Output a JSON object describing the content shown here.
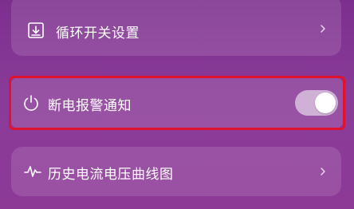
{
  "settings": {
    "items": [
      {
        "label": "循环开关设置",
        "icon": "download-box-icon",
        "control": "chevron"
      },
      {
        "label": "断电报警通知",
        "icon": "power-icon",
        "control": "toggle",
        "toggle_on": true
      },
      {
        "label": "历史电流电压曲线图",
        "icon": "waveform-icon",
        "control": "chevron"
      }
    ]
  }
}
